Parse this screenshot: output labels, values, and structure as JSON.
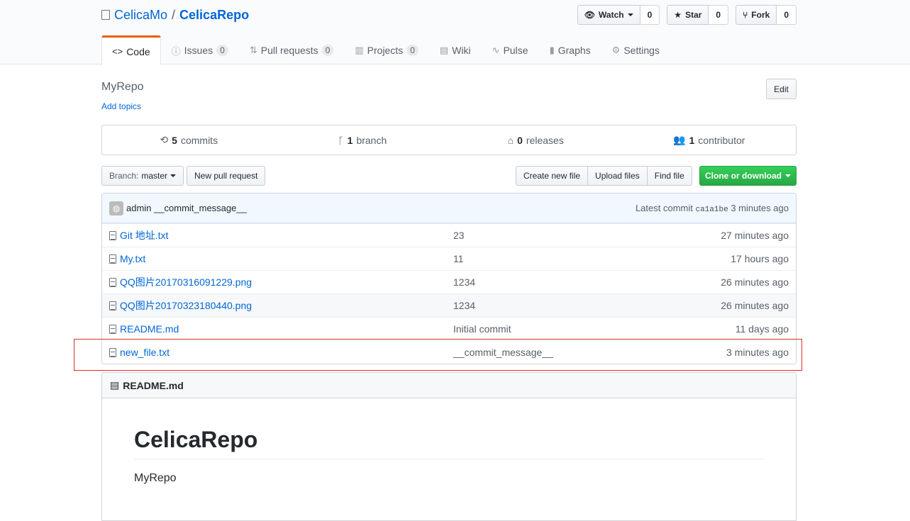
{
  "repo": {
    "owner": "CelicaMo",
    "separator": "/",
    "name": "CelicaRepo"
  },
  "actions": {
    "watch": {
      "label": "Watch",
      "count": "0"
    },
    "star": {
      "label": "Star",
      "count": "0"
    },
    "fork": {
      "label": "Fork",
      "count": "0"
    }
  },
  "tabs": [
    {
      "label": "Code",
      "icon": "code-icon"
    },
    {
      "label": "Issues",
      "count": "0",
      "icon": "issue-icon"
    },
    {
      "label": "Pull requests",
      "count": "0",
      "icon": "pull-request-icon"
    },
    {
      "label": "Projects",
      "count": "0",
      "icon": "project-icon"
    },
    {
      "label": "Wiki",
      "icon": "book-icon"
    },
    {
      "label": "Pulse",
      "icon": "pulse-icon"
    },
    {
      "label": "Graphs",
      "icon": "graph-icon"
    },
    {
      "label": "Settings",
      "icon": "gear-icon"
    }
  ],
  "description": "MyRepo",
  "add_topics": "Add topics",
  "edit_label": "Edit",
  "summary": {
    "commits": {
      "count": "5",
      "label": "commits"
    },
    "branches": {
      "count": "1",
      "label": "branch"
    },
    "releases": {
      "count": "0",
      "label": "releases"
    },
    "contributors": {
      "count": "1",
      "label": "contributor"
    }
  },
  "toolbar": {
    "branch_label": "Branch:",
    "branch_value": "master",
    "new_pr": "New pull request",
    "create_file": "Create new file",
    "upload_files": "Upload files",
    "find_file": "Find file",
    "clone": "Clone or download"
  },
  "commit_tease": {
    "author": "admin",
    "message": "__commit_message__",
    "latest_label": "Latest commit",
    "sha": "ca1a1be",
    "age": "3 minutes ago"
  },
  "files": [
    {
      "name": "Git 地址.txt",
      "message": "23",
      "age": "27 minutes ago"
    },
    {
      "name": "My.txt",
      "message": "11",
      "age": "17 hours ago"
    },
    {
      "name": "QQ图片20170316091229.png",
      "message": "1234",
      "age": "26 minutes ago"
    },
    {
      "name": "QQ图片20170323180440.png",
      "message": "1234",
      "age": "26 minutes ago"
    },
    {
      "name": "README.md",
      "message": "Initial commit",
      "age": "11 days ago"
    },
    {
      "name": "new_file.txt",
      "message": "__commit_message__",
      "age": "3 minutes ago"
    }
  ],
  "readme": {
    "filename": "README.md",
    "heading": "CelicaRepo",
    "body": "MyRepo"
  },
  "colors": {
    "accent_tab": "#e36209",
    "link": "#0366d6",
    "clone_green": "#28a745",
    "highlight_red": "#d93025"
  }
}
